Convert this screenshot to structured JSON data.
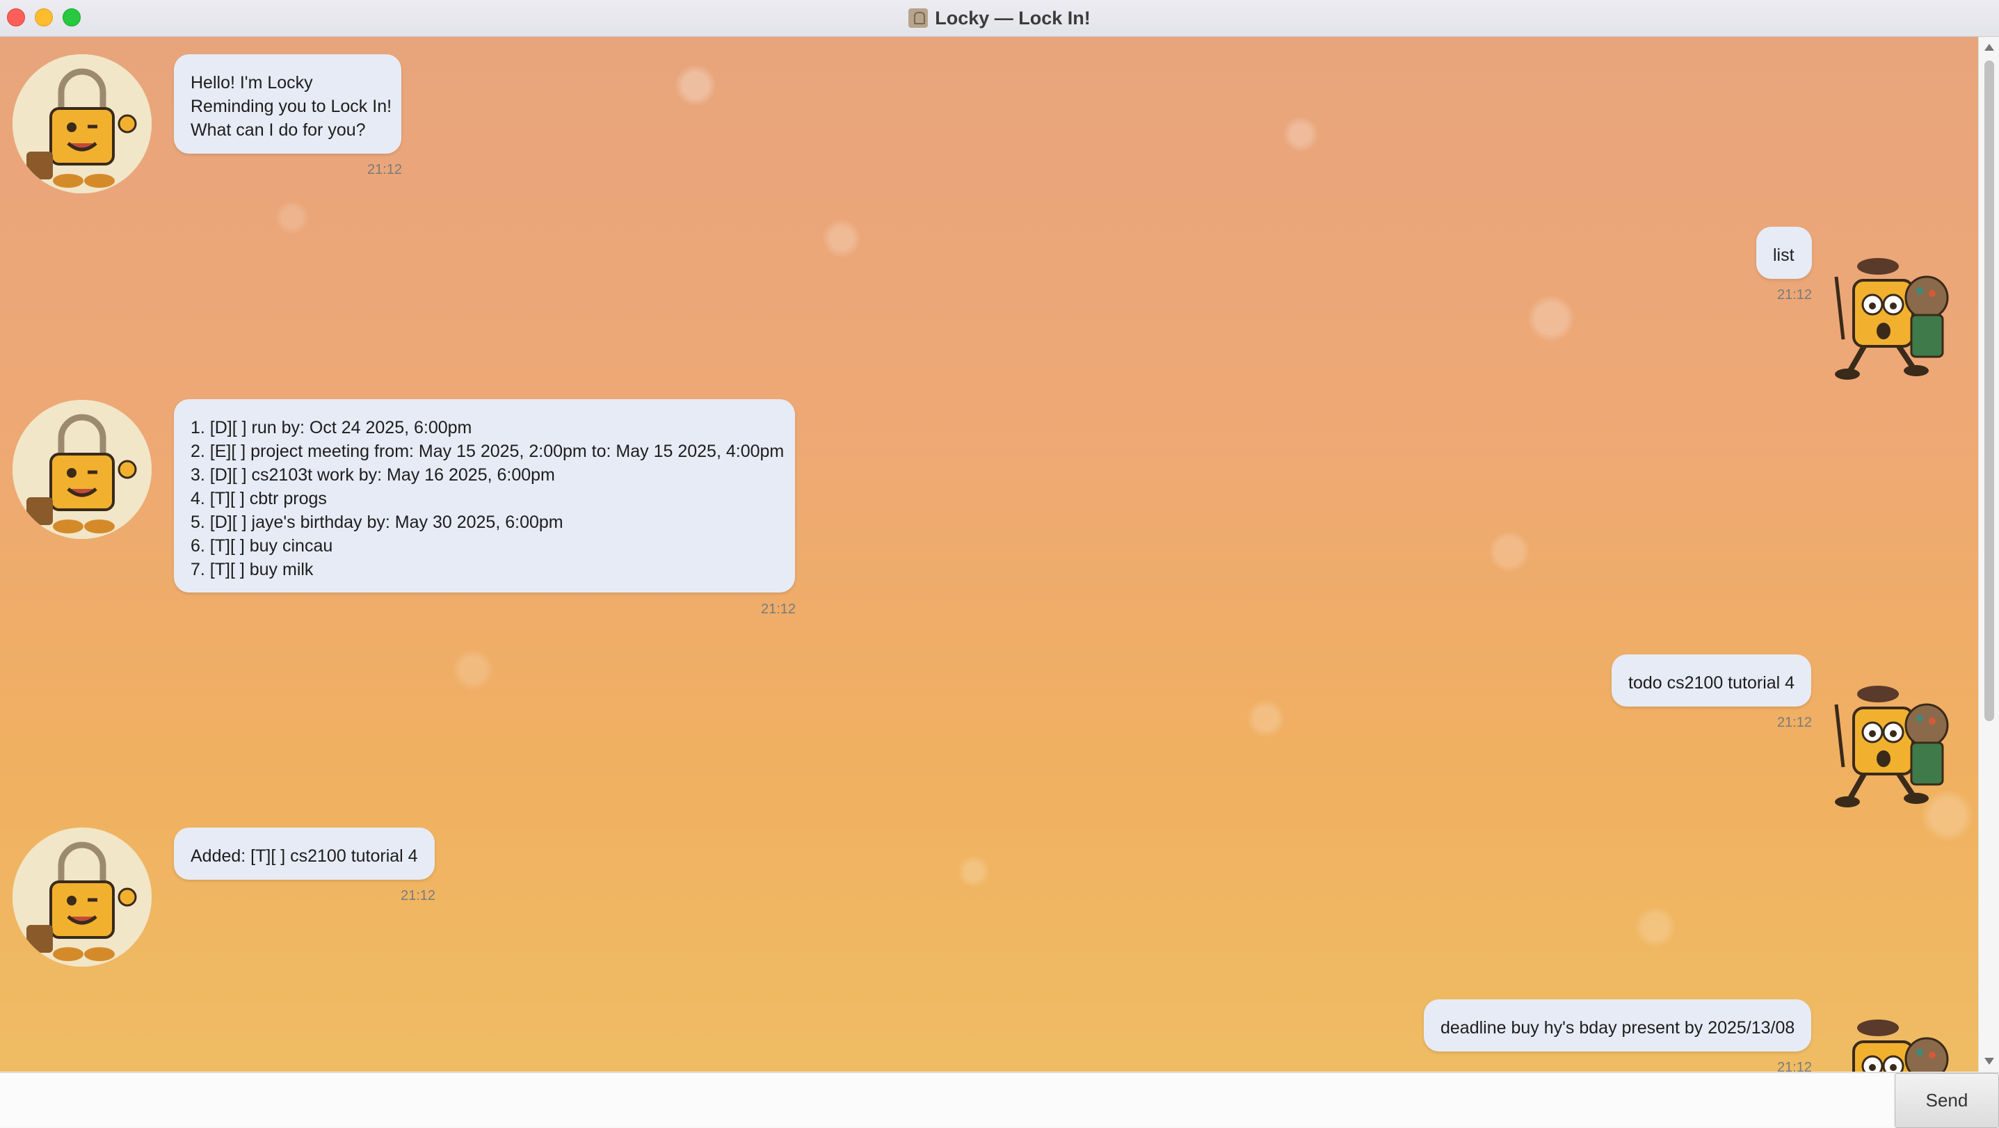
{
  "window": {
    "title": "Locky — Lock In!",
    "app_icon": "lock-app-icon"
  },
  "colors": {
    "bubble": "#e7ebf5",
    "background_top": "#e8a57c",
    "background_bottom": "#efbc63"
  },
  "messages": [
    {
      "sender": "bot",
      "text": "Hello! I'm Locky\nReminding you to Lock In!\nWhat can I do for you?",
      "time": "21:12"
    },
    {
      "sender": "user",
      "text": "list",
      "time": "21:12"
    },
    {
      "sender": "bot",
      "text": "1. [D][ ] run by: Oct 24 2025, 6:00pm\n2. [E][ ] project meeting from: May 15 2025, 2:00pm to: May 15 2025, 4:00pm\n3. [D][ ] cs2103t work by: May 16 2025, 6:00pm\n4. [T][ ] cbtr progs\n5. [D][ ] jaye's birthday by: May 30 2025, 6:00pm\n6. [T][ ] buy cincau\n7. [T][ ] buy milk",
      "time": "21:12"
    },
    {
      "sender": "user",
      "text": "todo cs2100 tutorial 4",
      "time": "21:12"
    },
    {
      "sender": "bot",
      "text": "Added: [T][ ] cs2100 tutorial 4",
      "time": "21:12"
    },
    {
      "sender": "user",
      "text": "deadline buy hy's bday present by 2025/13/08",
      "time": "21:12"
    }
  ],
  "input": {
    "value": "",
    "placeholder": ""
  },
  "send_button": {
    "label": "Send"
  }
}
